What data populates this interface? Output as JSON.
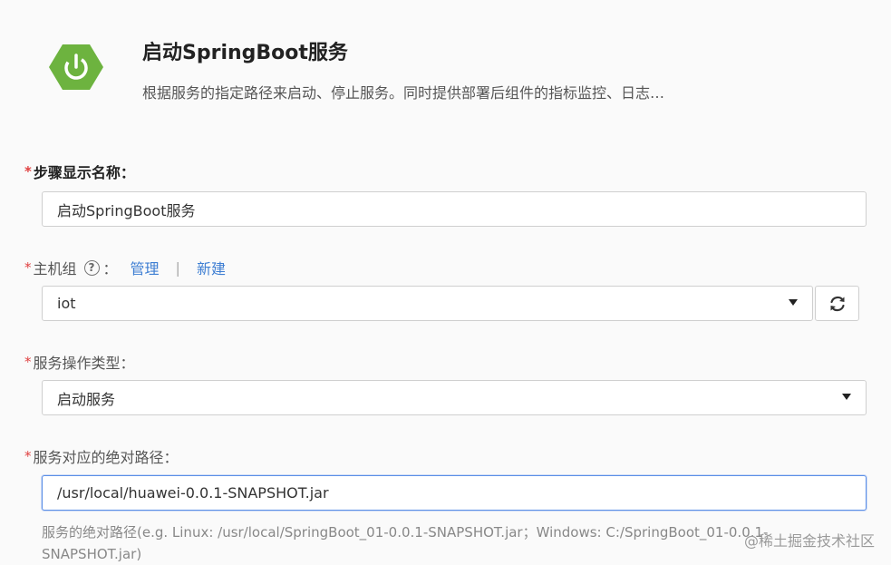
{
  "header": {
    "title": "启动SpringBoot服务",
    "description": "根据服务的指定路径来启动、停止服务。同时提供部署后组件的指标监控、日志…",
    "logo_color": "#6db33f"
  },
  "form": {
    "step_name": {
      "required_mark": "*",
      "label": "步骤显示名称：",
      "value": "启动SpringBoot服务"
    },
    "host_group": {
      "required_mark": "*",
      "label": "主机组",
      "help_glyph": "?",
      "colon": "：",
      "manage_link": "管理",
      "separator": "|",
      "new_link": "新建",
      "selected": "iot"
    },
    "service_op": {
      "required_mark": "*",
      "label": "服务操作类型：",
      "selected": "启动服务"
    },
    "abs_path": {
      "required_mark": "*",
      "label": "服务对应的绝对路径：",
      "value": "/usr/local/huawei-0.0.1-SNAPSHOT.jar",
      "hint": "服务的绝对路径(e.g. Linux: /usr/local/SpringBoot_01-0.0.1-SNAPSHOT.jar；Windows: C:/SpringBoot_01-0.0.1-SNAPSHOT.jar)"
    }
  },
  "watermark": "@稀土掘金技术社区",
  "colors": {
    "required": "#e04040",
    "link": "#3f7fd3",
    "focus_border": "#5b8fe6"
  }
}
